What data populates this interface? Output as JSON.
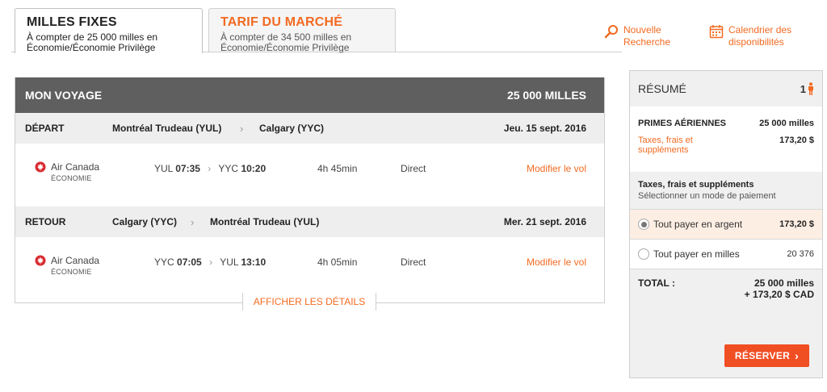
{
  "tabs": [
    {
      "title": "MILLES FIXES",
      "sub1": "À compter de  25 000 milles en",
      "sub2": "Économie/Économie Privilège"
    },
    {
      "title": "TARIF DU MARCHÉ",
      "sub1": "À compter de  34 500 milles en",
      "sub2": "Économie/Économie Privilège"
    }
  ],
  "links": {
    "new_search": {
      "line1": "Nouvelle",
      "line2": "Recherche",
      "icon": "search-icon"
    },
    "calendar": {
      "line1": "Calendrier des",
      "line2": "disponibilités",
      "icon": "calendar-icon"
    }
  },
  "voyage": {
    "title": "MON VOYAGE",
    "total": "25 000 MILLES",
    "segments": [
      {
        "label": "DÉPART",
        "from": "Montréal Trudeau (YUL)",
        "to": "Calgary (YYC)",
        "date": "Jeu. 15 sept. 2016",
        "airline": "Air Canada",
        "cabin": "ÉCONOMIE",
        "dep_code": "YUL",
        "dep_time": "07:35",
        "arr_code": "YYC",
        "arr_time": "10:20",
        "duration": "4h 45min",
        "stops": "Direct",
        "modify": "Modifier le vol"
      },
      {
        "label": "RETOUR",
        "from": "Calgary (YYC)",
        "to": "Montréal Trudeau (YUL)",
        "date": "Mer. 21 sept. 2016",
        "airline": "Air Canada",
        "cabin": "ÉCONOMIE",
        "dep_code": "YYC",
        "dep_time": "07:05",
        "arr_code": "YUL",
        "arr_time": "13:10",
        "duration": "4h 05min",
        "stops": "Direct",
        "modify": "Modifier le vol"
      }
    ],
    "details_link": "AFFICHER LES DÉTAILS"
  },
  "summary": {
    "title": "RÉSUMÉ",
    "passengers": "1",
    "primes_label": "PRIMES AÉRIENNES",
    "primes_value": "25 000 milles",
    "taxes_label1": "Taxes, frais et",
    "taxes_label2": "suppléments",
    "taxes_value": "173,20 $",
    "pay_title": "Taxes, frais et suppléments",
    "pay_sub": "Sélectionner un mode de paiement",
    "options": [
      {
        "label": "Tout payer en argent",
        "value": "173,20 $",
        "selected": true
      },
      {
        "label": "Tout payer en milles",
        "value": "20 376",
        "selected": false
      }
    ],
    "total_label": "TOTAL :",
    "total_line1": "25 000  milles",
    "total_line2": "+ 173,20 $ CAD",
    "reserve": "RÉSERVER"
  },
  "colors": {
    "accent": "#f26a21",
    "button": "#f04e23",
    "header": "#5f5f5f"
  }
}
